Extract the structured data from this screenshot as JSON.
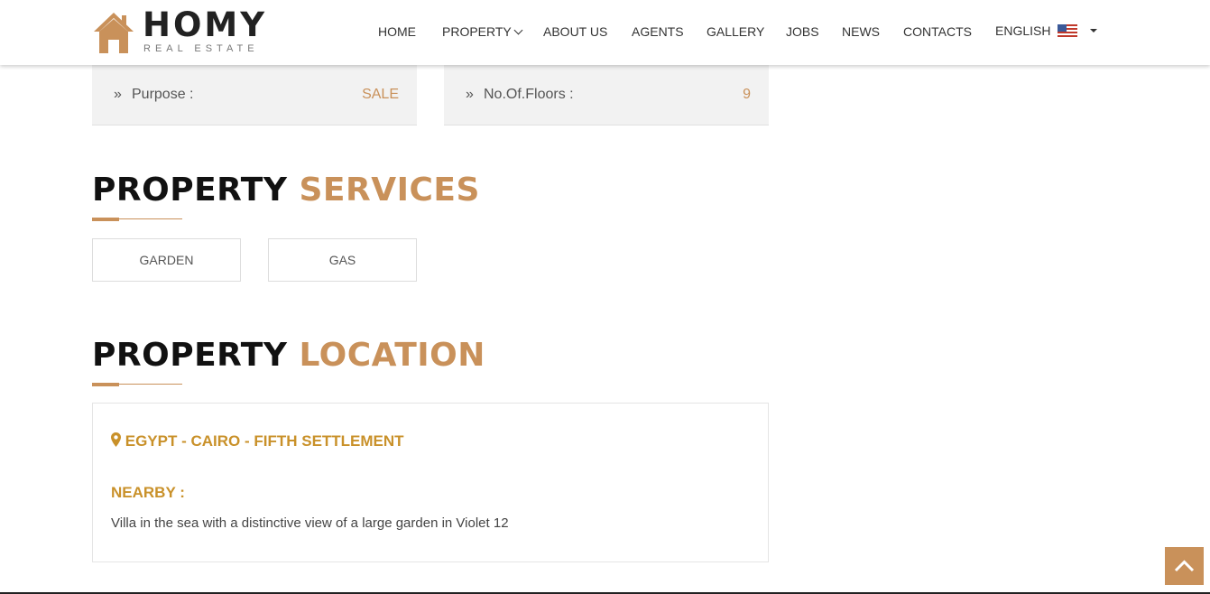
{
  "brand": {
    "title": "HOMY",
    "subtitle": "REAL ESTATE"
  },
  "nav": {
    "items": [
      "HOME",
      "PROPERTY",
      "ABOUT US",
      "AGENTS",
      "GALLERY",
      "JOBS",
      "NEWS",
      "CONTACTS"
    ],
    "language": "ENGLISH"
  },
  "details": [
    {
      "label": "Purpose :",
      "value": "SALE"
    },
    {
      "label": "No.Of.Floors :",
      "value": "9"
    }
  ],
  "services": {
    "title_main": "PROPERTY",
    "title_accent": "SERVICES",
    "tags": [
      "GARDEN",
      "GAS"
    ]
  },
  "location": {
    "title_main": "PROPERTY",
    "title_accent": "LOCATION",
    "address": "EGYPT - CAIRO - FIFTH SETTLEMENT",
    "nearby_label": "NEARBY :",
    "nearby_text": "Villa in the sea with a distinctive view of a large garden in Violet 12"
  },
  "colors": {
    "accent": "#c9915a",
    "location_text": "#c9912a",
    "panel": "#f2f2f2"
  },
  "icons": {
    "detail_bullet": "double-chevron-right-icon",
    "location": "map-marker-icon",
    "scroll_top": "chevron-up-icon"
  }
}
